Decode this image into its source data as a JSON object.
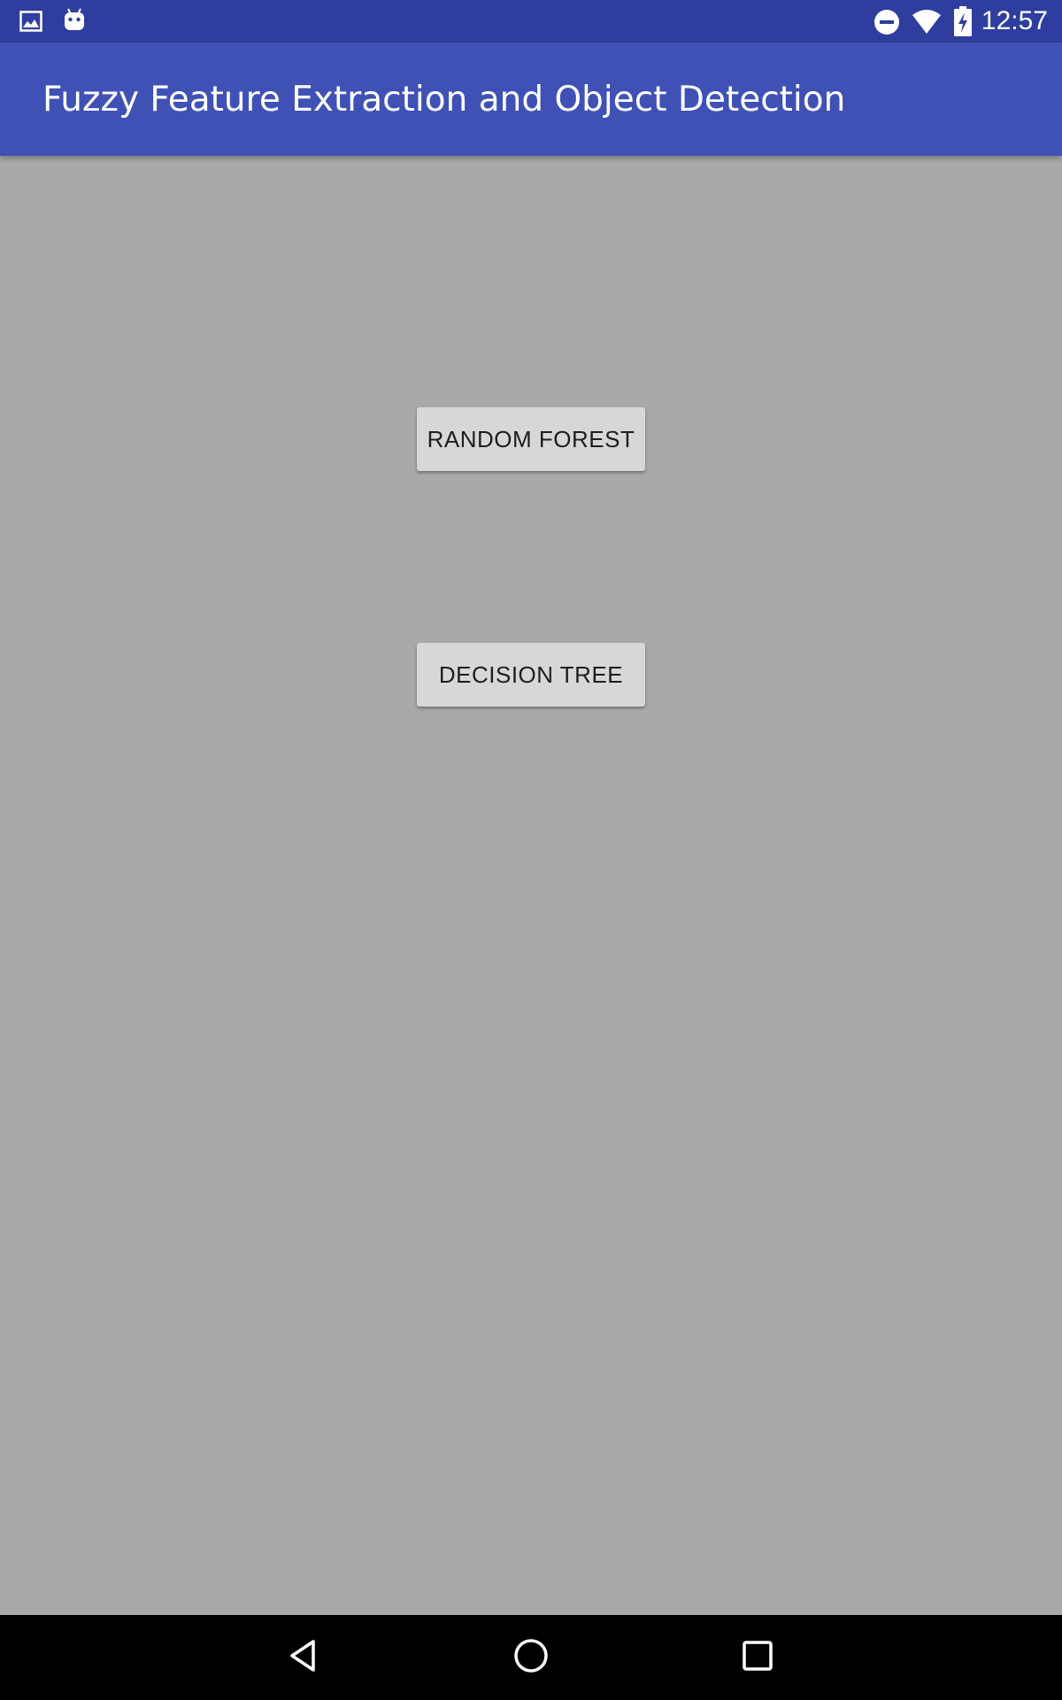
{
  "status_bar": {
    "time": "12:57",
    "background_color": "#2f3e9e",
    "left_icons": [
      "image-icon",
      "android-icon"
    ],
    "right_icons": [
      "do-not-disturb-icon",
      "wifi-icon",
      "battery-charging-icon"
    ]
  },
  "app_bar": {
    "title": "Fuzzy Feature Extraction and Object Detection",
    "background_color": "#3f51b5"
  },
  "main": {
    "background_color": "#a9a9a9",
    "buttons": [
      {
        "label": "RANDOM FOREST"
      },
      {
        "label": "DECISION TREE"
      }
    ]
  },
  "nav_bar": {
    "items": [
      "back-icon",
      "home-icon",
      "recents-icon"
    ]
  }
}
